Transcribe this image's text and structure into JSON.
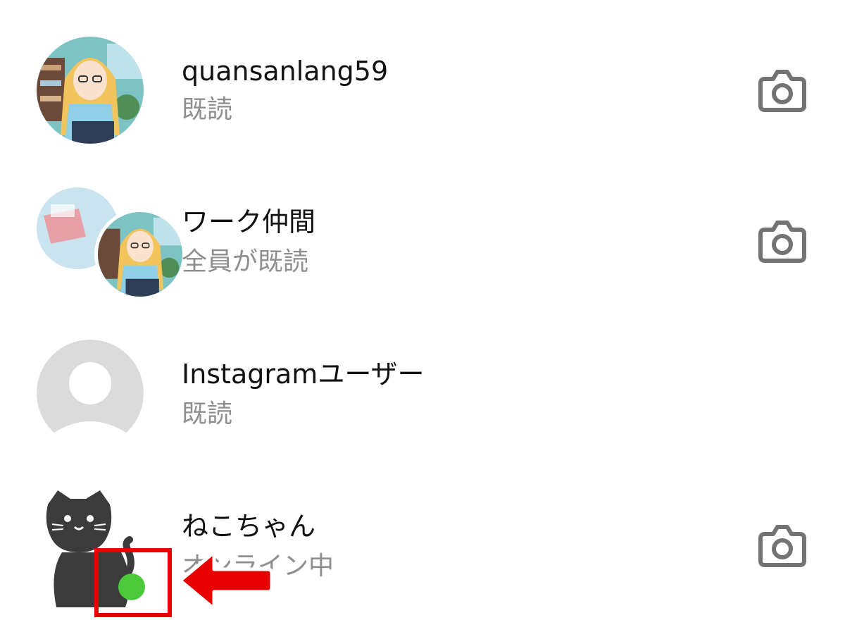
{
  "conversations": [
    {
      "name": "quansanlang59",
      "status": "既読",
      "avatar": "anime-girl-avatar",
      "camera": true
    },
    {
      "name": "ワーク仲間",
      "status": "全員が既読",
      "avatar": "group-avatar",
      "camera": true
    },
    {
      "name": "Instagramユーザー",
      "status": "既読",
      "avatar": "default-user-avatar",
      "camera": false
    },
    {
      "name": "ねこちゃん",
      "status": "オンライン中",
      "avatar": "black-cat-avatar",
      "camera": true,
      "online": true
    }
  ],
  "colors": {
    "online_dot": "#4cc93a",
    "annotation": "#e60000",
    "name_text": "#111111",
    "status_text": "#8e8e8e",
    "icon": "#737373"
  }
}
